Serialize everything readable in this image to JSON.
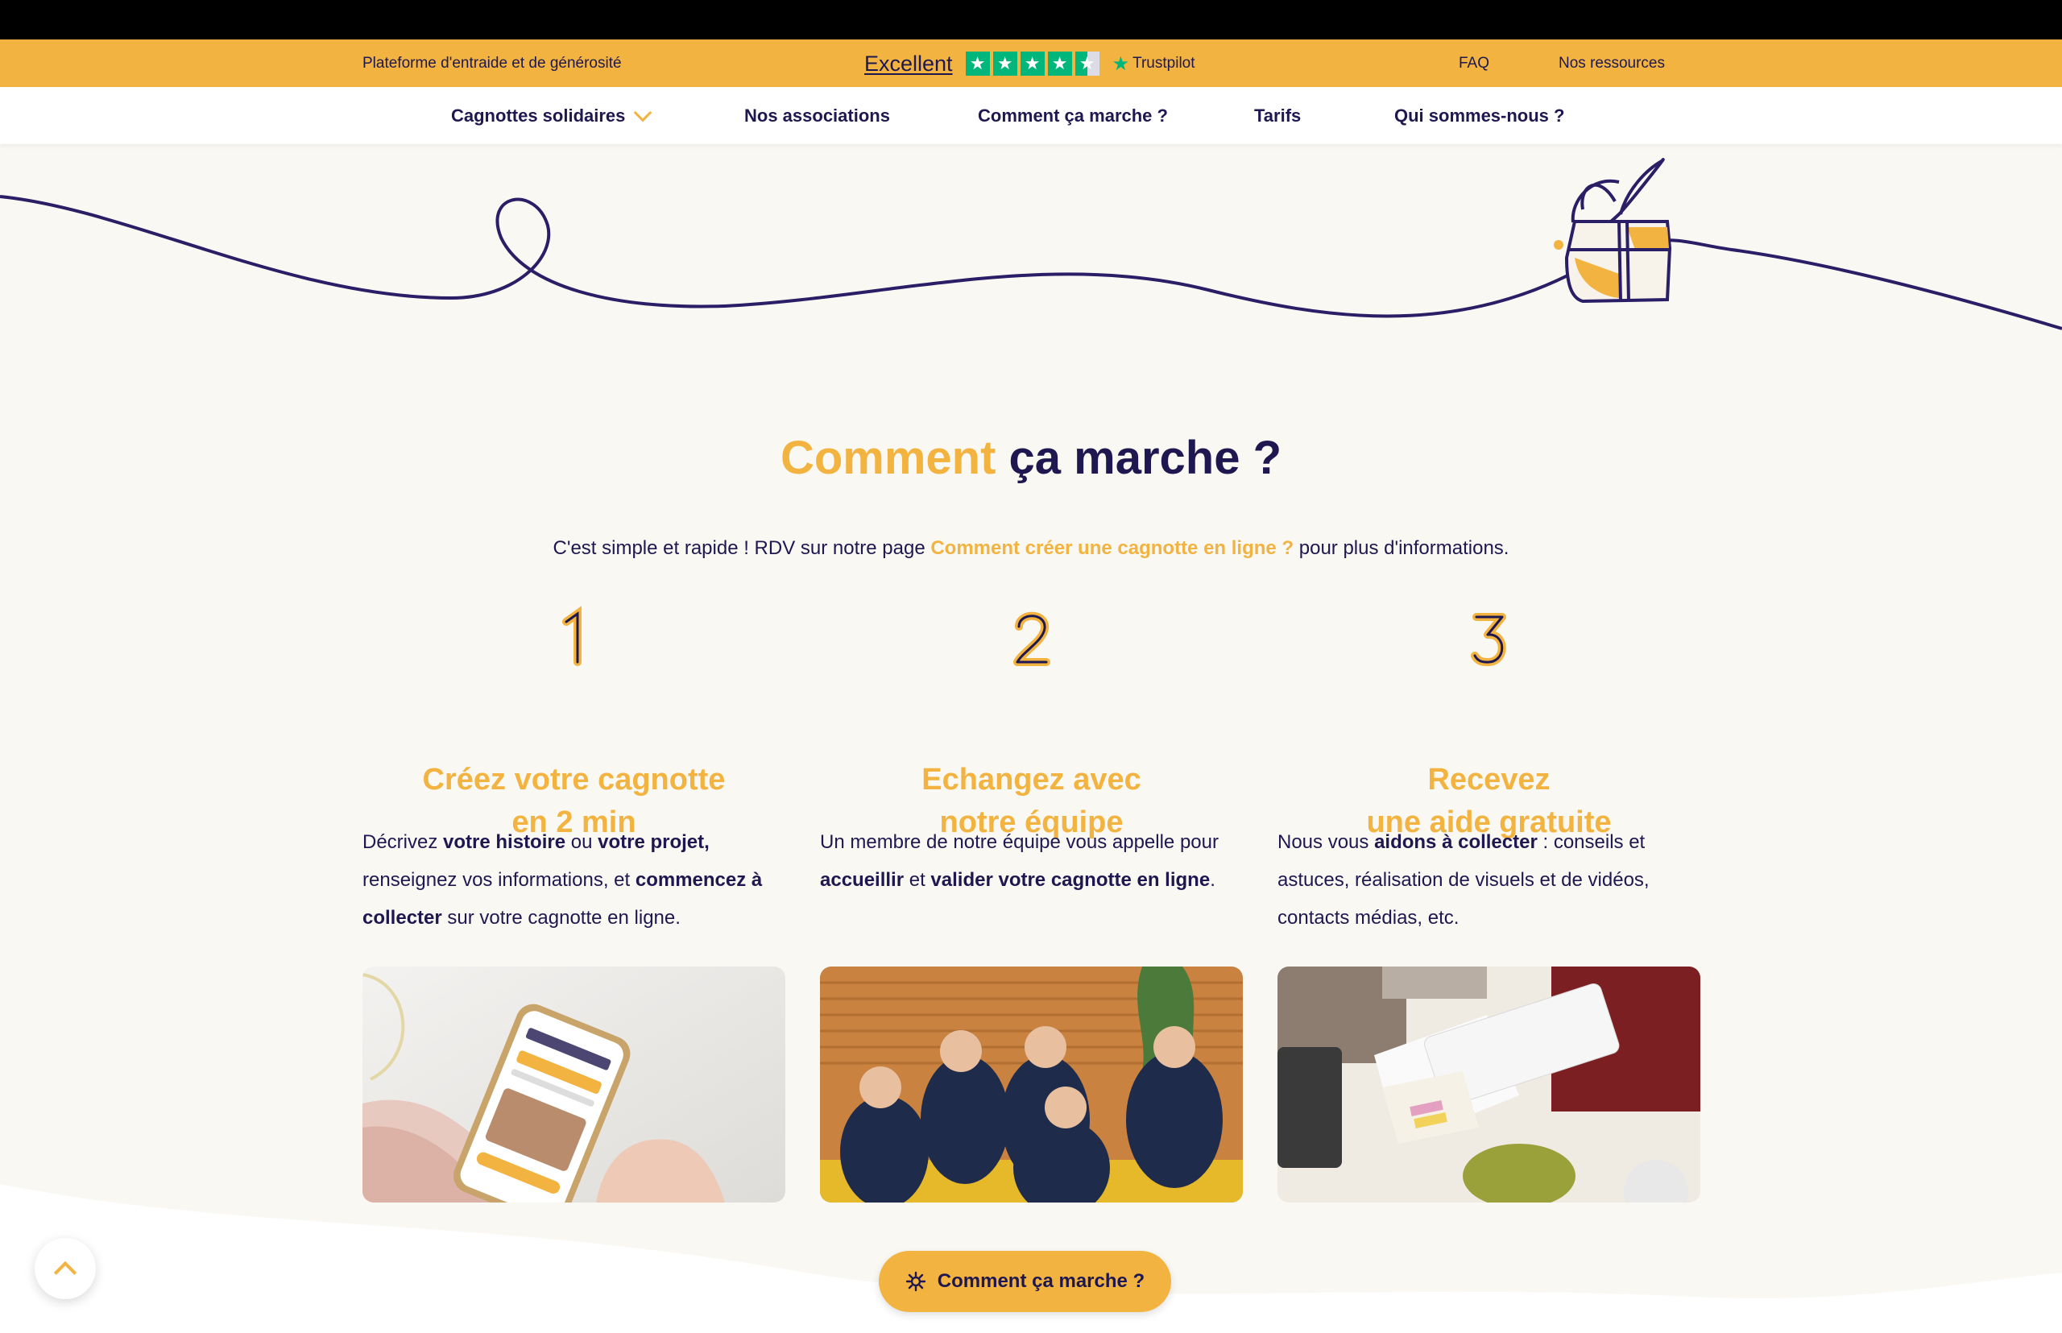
{
  "topbar": {
    "tagline": "Plateforme d'entraide et de générosité",
    "rating_label": "Excellent",
    "brand": "Trustpilot",
    "star_icon": "★",
    "links": [
      "FAQ",
      "Nos ressources"
    ]
  },
  "nav": {
    "items": [
      {
        "label": "Cagnottes solidaires",
        "has_dropdown": true
      },
      {
        "label": "Nos associations"
      },
      {
        "label": "Comment ça marche ?"
      },
      {
        "label": "Tarifs"
      },
      {
        "label": "Qui sommes-nous ?"
      }
    ]
  },
  "section": {
    "title_highlight": "Comment",
    "title_rest": " ça marche ?",
    "subtitle_before": "C'est simple et rapide ! RDV sur notre page ",
    "subtitle_link": "Comment créer une cagnotte en ligne ?",
    "subtitle_after": " pour plus d'informations."
  },
  "steps": [
    {
      "number": "1",
      "title_line1": "Créez votre cagnotte",
      "title_line2": "en 2 min",
      "text": [
        {
          "t": "Décrivez ",
          "b": false
        },
        {
          "t": "votre histoire",
          "b": true
        },
        {
          "t": " ou ",
          "b": false
        },
        {
          "t": "votre projet,",
          "b": true
        },
        {
          "t": " renseignez vos informations, et ",
          "b": false
        },
        {
          "t": "commencez à collecter",
          "b": true
        },
        {
          "t": " sur votre cagnotte en ligne.",
          "b": false
        }
      ],
      "photo": "phone-app-photo"
    },
    {
      "number": "2",
      "title_line1": "Echangez avec",
      "title_line2": "notre équipe",
      "text": [
        {
          "t": "Un membre de notre équipe vous appelle pour ",
          "b": false
        },
        {
          "t": "accueillir",
          "b": true
        },
        {
          "t": " et ",
          "b": false
        },
        {
          "t": "valider votre cagnotte en ligne",
          "b": true
        },
        {
          "t": ".",
          "b": false
        }
      ],
      "photo": "team-photo"
    },
    {
      "number": "3",
      "title_line1": "Recevez",
      "title_line2": "une aide gratuite",
      "text": [
        {
          "t": "Nous vous ",
          "b": false
        },
        {
          "t": "aidons à collecter",
          "b": true
        },
        {
          "t": " : conseils et astuces, réalisation de visuels et de vidéos, contacts médias, etc.",
          "b": false
        }
      ],
      "photo": "desk-photo"
    }
  ],
  "cta": {
    "label": "Comment ça marche ?",
    "icon": "gear-icon"
  },
  "scroll_top": {
    "icon": "chevron-up-icon"
  },
  "colors": {
    "accent": "#f2b340",
    "navy": "#1f1850",
    "background": "#faf8f3"
  }
}
